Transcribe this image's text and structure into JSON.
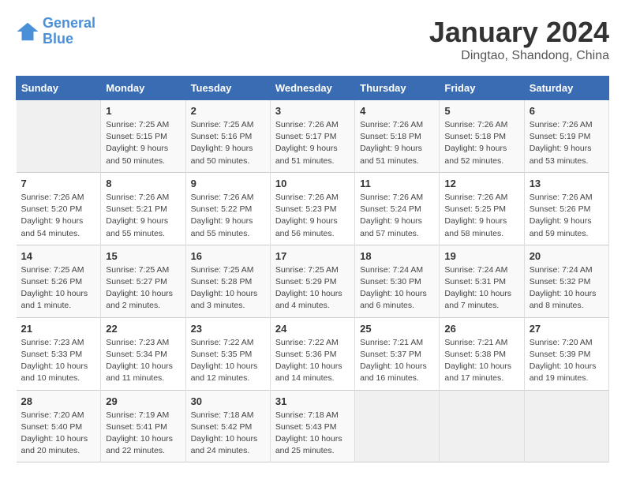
{
  "logo": {
    "line1": "General",
    "line2": "Blue"
  },
  "title": "January 2024",
  "location": "Dingtao, Shandong, China",
  "days_of_week": [
    "Sunday",
    "Monday",
    "Tuesday",
    "Wednesday",
    "Thursday",
    "Friday",
    "Saturday"
  ],
  "weeks": [
    [
      {
        "day": "",
        "info": ""
      },
      {
        "day": "1",
        "info": "Sunrise: 7:25 AM\nSunset: 5:15 PM\nDaylight: 9 hours\nand 50 minutes."
      },
      {
        "day": "2",
        "info": "Sunrise: 7:25 AM\nSunset: 5:16 PM\nDaylight: 9 hours\nand 50 minutes."
      },
      {
        "day": "3",
        "info": "Sunrise: 7:26 AM\nSunset: 5:17 PM\nDaylight: 9 hours\nand 51 minutes."
      },
      {
        "day": "4",
        "info": "Sunrise: 7:26 AM\nSunset: 5:18 PM\nDaylight: 9 hours\nand 51 minutes."
      },
      {
        "day": "5",
        "info": "Sunrise: 7:26 AM\nSunset: 5:18 PM\nDaylight: 9 hours\nand 52 minutes."
      },
      {
        "day": "6",
        "info": "Sunrise: 7:26 AM\nSunset: 5:19 PM\nDaylight: 9 hours\nand 53 minutes."
      }
    ],
    [
      {
        "day": "7",
        "info": "Sunrise: 7:26 AM\nSunset: 5:20 PM\nDaylight: 9 hours\nand 54 minutes."
      },
      {
        "day": "8",
        "info": "Sunrise: 7:26 AM\nSunset: 5:21 PM\nDaylight: 9 hours\nand 55 minutes."
      },
      {
        "day": "9",
        "info": "Sunrise: 7:26 AM\nSunset: 5:22 PM\nDaylight: 9 hours\nand 55 minutes."
      },
      {
        "day": "10",
        "info": "Sunrise: 7:26 AM\nSunset: 5:23 PM\nDaylight: 9 hours\nand 56 minutes."
      },
      {
        "day": "11",
        "info": "Sunrise: 7:26 AM\nSunset: 5:24 PM\nDaylight: 9 hours\nand 57 minutes."
      },
      {
        "day": "12",
        "info": "Sunrise: 7:26 AM\nSunset: 5:25 PM\nDaylight: 9 hours\nand 58 minutes."
      },
      {
        "day": "13",
        "info": "Sunrise: 7:26 AM\nSunset: 5:26 PM\nDaylight: 9 hours\nand 59 minutes."
      }
    ],
    [
      {
        "day": "14",
        "info": "Sunrise: 7:25 AM\nSunset: 5:26 PM\nDaylight: 10 hours\nand 1 minute."
      },
      {
        "day": "15",
        "info": "Sunrise: 7:25 AM\nSunset: 5:27 PM\nDaylight: 10 hours\nand 2 minutes."
      },
      {
        "day": "16",
        "info": "Sunrise: 7:25 AM\nSunset: 5:28 PM\nDaylight: 10 hours\nand 3 minutes."
      },
      {
        "day": "17",
        "info": "Sunrise: 7:25 AM\nSunset: 5:29 PM\nDaylight: 10 hours\nand 4 minutes."
      },
      {
        "day": "18",
        "info": "Sunrise: 7:24 AM\nSunset: 5:30 PM\nDaylight: 10 hours\nand 6 minutes."
      },
      {
        "day": "19",
        "info": "Sunrise: 7:24 AM\nSunset: 5:31 PM\nDaylight: 10 hours\nand 7 minutes."
      },
      {
        "day": "20",
        "info": "Sunrise: 7:24 AM\nSunset: 5:32 PM\nDaylight: 10 hours\nand 8 minutes."
      }
    ],
    [
      {
        "day": "21",
        "info": "Sunrise: 7:23 AM\nSunset: 5:33 PM\nDaylight: 10 hours\nand 10 minutes."
      },
      {
        "day": "22",
        "info": "Sunrise: 7:23 AM\nSunset: 5:34 PM\nDaylight: 10 hours\nand 11 minutes."
      },
      {
        "day": "23",
        "info": "Sunrise: 7:22 AM\nSunset: 5:35 PM\nDaylight: 10 hours\nand 12 minutes."
      },
      {
        "day": "24",
        "info": "Sunrise: 7:22 AM\nSunset: 5:36 PM\nDaylight: 10 hours\nand 14 minutes."
      },
      {
        "day": "25",
        "info": "Sunrise: 7:21 AM\nSunset: 5:37 PM\nDaylight: 10 hours\nand 16 minutes."
      },
      {
        "day": "26",
        "info": "Sunrise: 7:21 AM\nSunset: 5:38 PM\nDaylight: 10 hours\nand 17 minutes."
      },
      {
        "day": "27",
        "info": "Sunrise: 7:20 AM\nSunset: 5:39 PM\nDaylight: 10 hours\nand 19 minutes."
      }
    ],
    [
      {
        "day": "28",
        "info": "Sunrise: 7:20 AM\nSunset: 5:40 PM\nDaylight: 10 hours\nand 20 minutes."
      },
      {
        "day": "29",
        "info": "Sunrise: 7:19 AM\nSunset: 5:41 PM\nDaylight: 10 hours\nand 22 minutes."
      },
      {
        "day": "30",
        "info": "Sunrise: 7:18 AM\nSunset: 5:42 PM\nDaylight: 10 hours\nand 24 minutes."
      },
      {
        "day": "31",
        "info": "Sunrise: 7:18 AM\nSunset: 5:43 PM\nDaylight: 10 hours\nand 25 minutes."
      },
      {
        "day": "",
        "info": ""
      },
      {
        "day": "",
        "info": ""
      },
      {
        "day": "",
        "info": ""
      }
    ]
  ]
}
